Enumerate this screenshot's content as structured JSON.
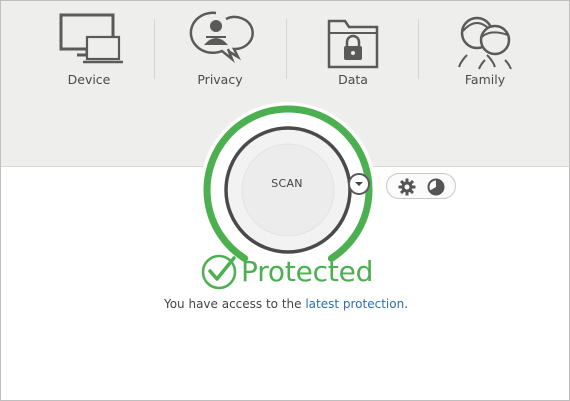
{
  "nav": {
    "items": [
      {
        "label": "Device",
        "icon": "device-icon"
      },
      {
        "label": "Privacy",
        "icon": "privacy-icon"
      },
      {
        "label": "Data",
        "icon": "data-lock-icon"
      },
      {
        "label": "Family",
        "icon": "family-icon"
      }
    ]
  },
  "scan": {
    "label": "SCAN",
    "ring_color": "#4cb050",
    "ring_progress": 0.82
  },
  "tools": {
    "dropdown_icon": "chevron-down-icon",
    "settings_icon": "gear-icon",
    "history_icon": "pie-chart-icon"
  },
  "status": {
    "icon": "check-circle-icon",
    "text": "Protected",
    "color": "#4cb050"
  },
  "subtitle": {
    "prefix": "You have access to the ",
    "link": "latest protection",
    "suffix": "."
  }
}
